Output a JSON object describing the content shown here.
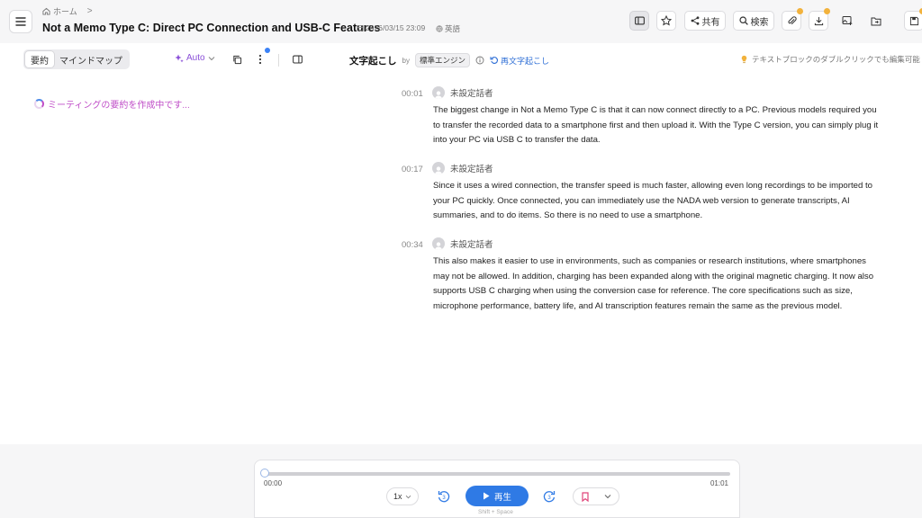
{
  "header": {
    "breadcrumb_home": "ホーム",
    "breadcrumb_sep": ">",
    "title": "Not a Memo Type C: Direct PC Connection and USB-C Features",
    "date": "2026/03/15 23:09",
    "language": "英語",
    "toolbar": {
      "share_label": "共有",
      "search_label": "検索"
    }
  },
  "left_panel": {
    "tabs": [
      {
        "label": "要約",
        "selected": true
      },
      {
        "label": "マインドマップ",
        "selected": false
      }
    ],
    "auto_label": "Auto",
    "loading_text": "ミーティングの要約を作成中です..."
  },
  "transcript": {
    "title": "文字起こし",
    "by": "by",
    "engine": "標準エンジン",
    "retranscribe_label": "再文字起こし",
    "hint": "テキストブロックのダブルクリックでも編集可能",
    "segments": [
      {
        "time": "00:01",
        "speaker": "未設定話者",
        "text": "The biggest change in Not a Memo Type C is that it can now connect directly to a PC. Previous models required you to transfer the recorded data to a smartphone first and then upload it. With the Type C version, you can simply plug it into your PC via USB C to transfer the data."
      },
      {
        "time": "00:17",
        "speaker": "未設定話者",
        "text": "Since it uses a wired connection, the transfer speed is much faster, allowing even long recordings to be imported to your PC quickly. Once connected, you can immediately use the NADA web version to generate transcripts, AI summaries, and to do items. So there is no need to use a smartphone."
      },
      {
        "time": "00:34",
        "speaker": "未設定話者",
        "text": "This also makes it easier to use in environments, such as companies or research institutions, where smartphones may not be allowed. In addition, charging has been expanded along with the original magnetic charging. It now also supports USB C charging when using the conversion case for reference. The core specifications such as size, microphone performance, battery life, and AI transcription features remain the same as the previous model."
      }
    ]
  },
  "player": {
    "current_time": "00:00",
    "duration": "01:01",
    "progress": 0,
    "speed": "1x",
    "skip_back_seconds": "3",
    "skip_forward_seconds": "3",
    "play_label": "再生",
    "shortcut_hint": "Shift + Space"
  },
  "colors": {
    "accent_blue": "#2f7ae5",
    "purple": "#8a4fd8",
    "loading_pink": "#c04fc8",
    "badge_orange": "#f2b23c"
  }
}
